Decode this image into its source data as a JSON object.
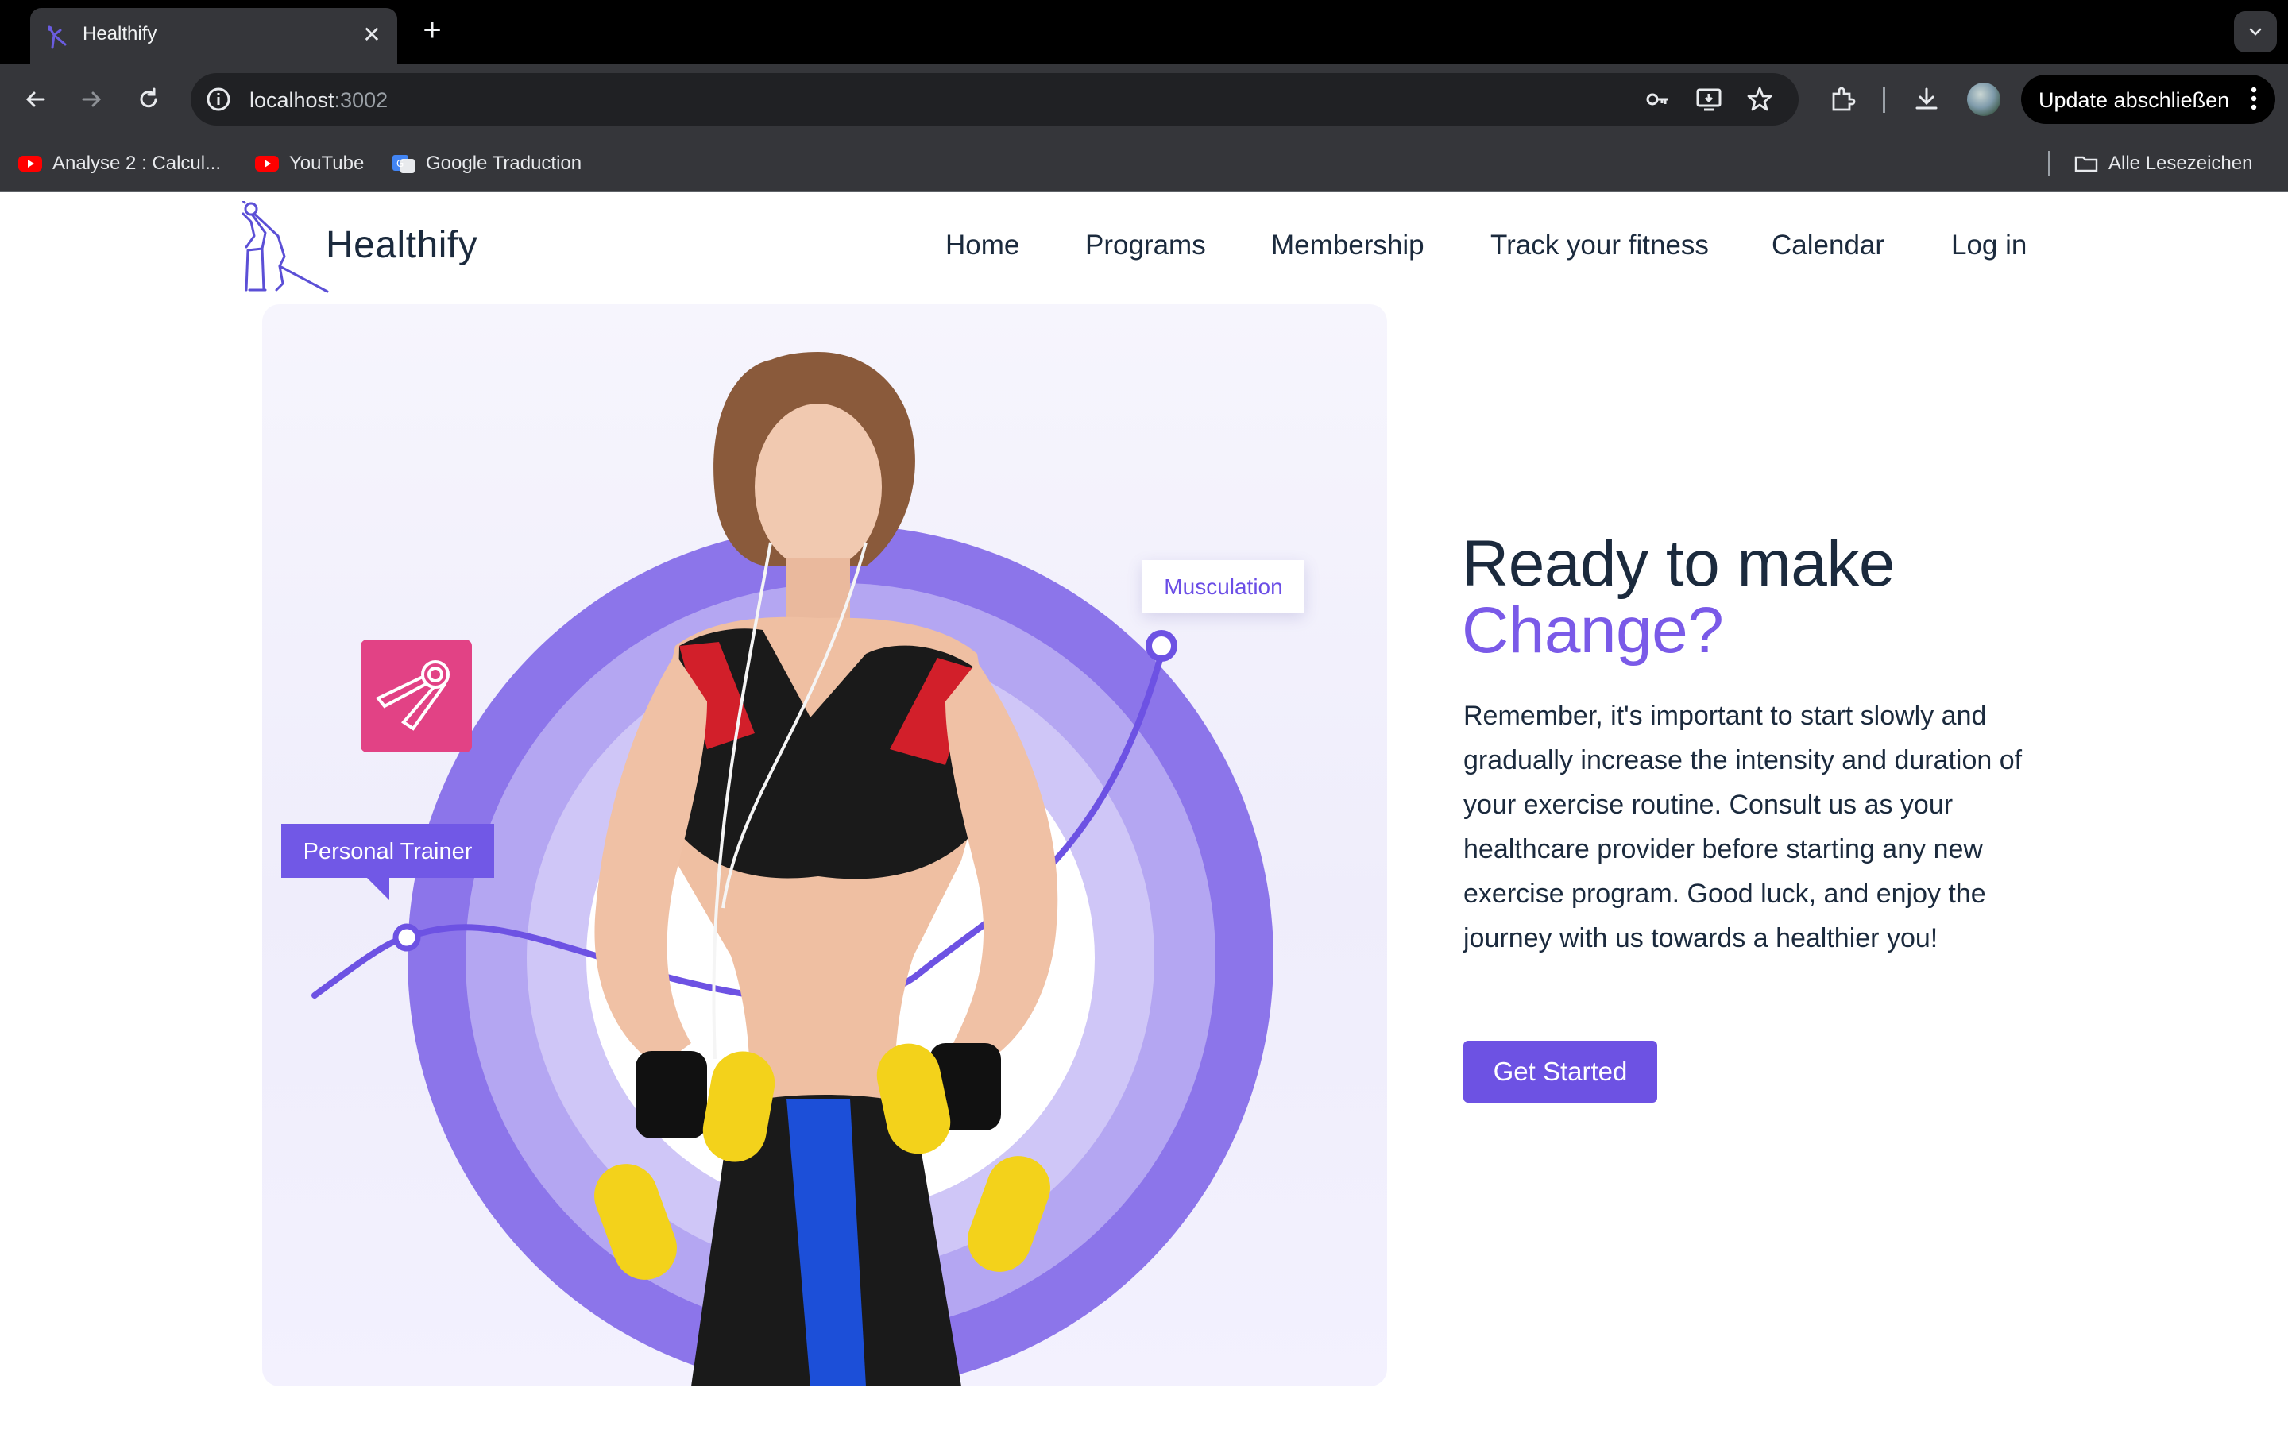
{
  "browser": {
    "tab_title": "Healthify",
    "url_host": "localhost",
    "url_port": ":3002",
    "update_label": "Update abschließen",
    "bookmarks": [
      {
        "label": "Analyse 2 : Calcul...",
        "icon": "youtube-icon"
      },
      {
        "label": "YouTube",
        "icon": "youtube-icon"
      },
      {
        "label": "Google Traduction",
        "icon": "google-translate-icon"
      }
    ],
    "all_bookmarks_label": "Alle Lesezeichen"
  },
  "site": {
    "brand": "Healthify",
    "nav": [
      "Home",
      "Programs",
      "Membership",
      "Track your fitness",
      "Calendar",
      "Log in"
    ]
  },
  "hero": {
    "tag_top": "Musculation",
    "tag_left": "Personal Trainer",
    "heading_line1": "Ready to make",
    "heading_line2": "Change?",
    "paragraph": "Remember, it's important to start slowly and gradually increase the intensity and duration of your exercise routine. Consult us as your healthcare provider before starting any new exercise program. Good luck, and enjoy the journey with us towards a healthier you!",
    "cta_label": "Get Started"
  },
  "colors": {
    "accent": "#6d52e3",
    "heading_dark": "#1b2a3d",
    "heading_accent": "#7a5ae8",
    "badge_pink": "#e24285",
    "chrome_dark": "#35363a"
  }
}
